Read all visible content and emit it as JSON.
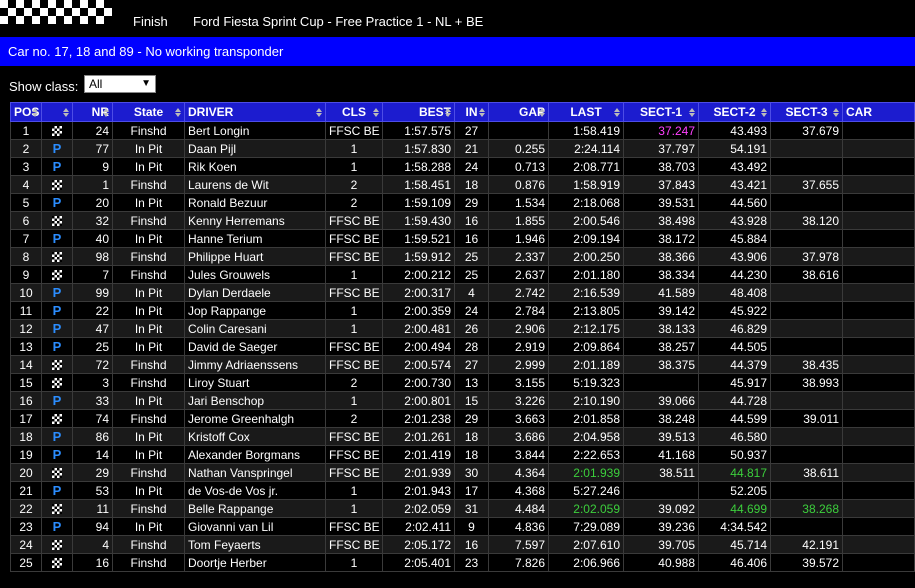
{
  "header": {
    "status": "Finish",
    "title": "Ford Fiesta Sprint Cup - Free Practice 1 - NL + BE"
  },
  "message": "Car no. 17, 18 and 89 - No working transponder",
  "class_filter": {
    "label": "Show class:",
    "value": "All"
  },
  "columns": [
    "POS",
    "",
    "NR",
    "State",
    "DRIVER",
    "CLS",
    "BEST",
    "IN",
    "GAP",
    "LAST",
    "SECT-1",
    "SECT-2",
    "SECT-3",
    "CAR"
  ],
  "colors": {
    "header_bg": "#1c1ccf",
    "message_bg": "#0000ff",
    "pit_icon": "#2b8dff",
    "best_overall": "#ff40ff",
    "personal_best": "#3ccf3c"
  },
  "icons": {
    "finished": "checkered-flag-icon",
    "in_pit": "pit-icon",
    "pit_glyph": "P"
  },
  "rows": [
    {
      "pos": "1",
      "icon": "flag",
      "nr": "24",
      "state": "Finshd",
      "driver": "Bert Longin",
      "cls": "FFSC BE",
      "best": "1:57.575",
      "in": "27",
      "gap": "",
      "last": "1:58.419",
      "s1": "37.247",
      "s2": "43.493",
      "s3": "37.679",
      "car": "",
      "s1c": "purple"
    },
    {
      "pos": "2",
      "icon": "pit",
      "nr": "77",
      "state": "In Pit",
      "driver": "Daan Pijl",
      "cls": "1",
      "best": "1:57.830",
      "in": "21",
      "gap": "0.255",
      "last": "2:24.114",
      "s1": "37.797",
      "s2": "54.191",
      "s3": "",
      "car": ""
    },
    {
      "pos": "3",
      "icon": "pit",
      "nr": "9",
      "state": "In Pit",
      "driver": "Rik Koen",
      "cls": "1",
      "best": "1:58.288",
      "in": "24",
      "gap": "0.713",
      "last": "2:08.771",
      "s1": "38.703",
      "s2": "43.492",
      "s3": "",
      "car": ""
    },
    {
      "pos": "4",
      "icon": "flag",
      "nr": "1",
      "state": "Finshd",
      "driver": "Laurens de Wit",
      "cls": "2",
      "best": "1:58.451",
      "in": "18",
      "gap": "0.876",
      "last": "1:58.919",
      "s1": "37.843",
      "s2": "43.421",
      "s3": "37.655",
      "car": ""
    },
    {
      "pos": "5",
      "icon": "pit",
      "nr": "20",
      "state": "In Pit",
      "driver": "Ronald Bezuur",
      "cls": "2",
      "best": "1:59.109",
      "in": "29",
      "gap": "1.534",
      "last": "2:18.068",
      "s1": "39.531",
      "s2": "44.560",
      "s3": "",
      "car": ""
    },
    {
      "pos": "6",
      "icon": "flag",
      "nr": "32",
      "state": "Finshd",
      "driver": "Kenny Herremans",
      "cls": "FFSC BE",
      "best": "1:59.430",
      "in": "16",
      "gap": "1.855",
      "last": "2:00.546",
      "s1": "38.498",
      "s2": "43.928",
      "s3": "38.120",
      "car": ""
    },
    {
      "pos": "7",
      "icon": "pit",
      "nr": "40",
      "state": "In Pit",
      "driver": "Hanne Terium",
      "cls": "FFSC BE",
      "best": "1:59.521",
      "in": "16",
      "gap": "1.946",
      "last": "2:09.194",
      "s1": "38.172",
      "s2": "45.884",
      "s3": "",
      "car": ""
    },
    {
      "pos": "8",
      "icon": "flag",
      "nr": "98",
      "state": "Finshd",
      "driver": "Philippe Huart",
      "cls": "FFSC BE",
      "best": "1:59.912",
      "in": "25",
      "gap": "2.337",
      "last": "2:00.250",
      "s1": "38.366",
      "s2": "43.906",
      "s3": "37.978",
      "car": ""
    },
    {
      "pos": "9",
      "icon": "flag",
      "nr": "7",
      "state": "Finshd",
      "driver": "Jules Grouwels",
      "cls": "1",
      "best": "2:00.212",
      "in": "25",
      "gap": "2.637",
      "last": "2:01.180",
      "s1": "38.334",
      "s2": "44.230",
      "s3": "38.616",
      "car": ""
    },
    {
      "pos": "10",
      "icon": "pit",
      "nr": "99",
      "state": "In Pit",
      "driver": "Dylan Derdaele",
      "cls": "FFSC BE",
      "best": "2:00.317",
      "in": "4",
      "gap": "2.742",
      "last": "2:16.539",
      "s1": "41.589",
      "s2": "48.408",
      "s3": "",
      "car": ""
    },
    {
      "pos": "11",
      "icon": "pit",
      "nr": "22",
      "state": "In Pit",
      "driver": "Jop Rappange",
      "cls": "1",
      "best": "2:00.359",
      "in": "24",
      "gap": "2.784",
      "last": "2:13.805",
      "s1": "39.142",
      "s2": "45.922",
      "s3": "",
      "car": ""
    },
    {
      "pos": "12",
      "icon": "pit",
      "nr": "47",
      "state": "In Pit",
      "driver": "Colin Caresani",
      "cls": "1",
      "best": "2:00.481",
      "in": "26",
      "gap": "2.906",
      "last": "2:12.175",
      "s1": "38.133",
      "s2": "46.829",
      "s3": "",
      "car": ""
    },
    {
      "pos": "13",
      "icon": "pit",
      "nr": "25",
      "state": "In Pit",
      "driver": "David de Saeger",
      "cls": "FFSC BE",
      "best": "2:00.494",
      "in": "28",
      "gap": "2.919",
      "last": "2:09.864",
      "s1": "38.257",
      "s2": "44.505",
      "s3": "",
      "car": ""
    },
    {
      "pos": "14",
      "icon": "flag",
      "nr": "72",
      "state": "Finshd",
      "driver": "Jimmy Adriaenssens",
      "cls": "FFSC BE",
      "best": "2:00.574",
      "in": "27",
      "gap": "2.999",
      "last": "2:01.189",
      "s1": "38.375",
      "s2": "44.379",
      "s3": "38.435",
      "car": ""
    },
    {
      "pos": "15",
      "icon": "flag",
      "nr": "3",
      "state": "Finshd",
      "driver": "Liroy Stuart",
      "cls": "2",
      "best": "2:00.730",
      "in": "13",
      "gap": "3.155",
      "last": "5:19.323",
      "s1": "",
      "s2": "45.917",
      "s3": "38.993",
      "car": ""
    },
    {
      "pos": "16",
      "icon": "pit",
      "nr": "33",
      "state": "In Pit",
      "driver": "Jari Benschop",
      "cls": "1",
      "best": "2:00.801",
      "in": "15",
      "gap": "3.226",
      "last": "2:10.190",
      "s1": "39.066",
      "s2": "44.728",
      "s3": "",
      "car": ""
    },
    {
      "pos": "17",
      "icon": "flag",
      "nr": "74",
      "state": "Finshd",
      "driver": "Jerome Greenhalgh",
      "cls": "2",
      "best": "2:01.238",
      "in": "29",
      "gap": "3.663",
      "last": "2:01.858",
      "s1": "38.248",
      "s2": "44.599",
      "s3": "39.011",
      "car": ""
    },
    {
      "pos": "18",
      "icon": "pit",
      "nr": "86",
      "state": "In Pit",
      "driver": "Kristoff Cox",
      "cls": "FFSC BE",
      "best": "2:01.261",
      "in": "18",
      "gap": "3.686",
      "last": "2:04.958",
      "s1": "39.513",
      "s2": "46.580",
      "s3": "",
      "car": ""
    },
    {
      "pos": "19",
      "icon": "pit",
      "nr": "14",
      "state": "In Pit",
      "driver": "Alexander Borgmans",
      "cls": "FFSC BE",
      "best": "2:01.419",
      "in": "18",
      "gap": "3.844",
      "last": "2:22.653",
      "s1": "41.168",
      "s2": "50.937",
      "s3": "",
      "car": ""
    },
    {
      "pos": "20",
      "icon": "flag",
      "nr": "29",
      "state": "Finshd",
      "driver": "Nathan Vanspringel",
      "cls": "FFSC BE",
      "best": "2:01.939",
      "in": "30",
      "gap": "4.364",
      "last": "2:01.939",
      "s1": "38.511",
      "s2": "44.817",
      "s3": "38.611",
      "car": "",
      "lastc": "green",
      "s2c": "green"
    },
    {
      "pos": "21",
      "icon": "pit",
      "nr": "53",
      "state": "In Pit",
      "driver": "de Vos-de Vos jr.",
      "cls": "1",
      "best": "2:01.943",
      "in": "17",
      "gap": "4.368",
      "last": "5:27.246",
      "s1": "",
      "s2": "52.205",
      "s3": "",
      "car": ""
    },
    {
      "pos": "22",
      "icon": "flag",
      "nr": "11",
      "state": "Finshd",
      "driver": "Belle Rappange",
      "cls": "1",
      "best": "2:02.059",
      "in": "31",
      "gap": "4.484",
      "last": "2:02.059",
      "s1": "39.092",
      "s2": "44.699",
      "s3": "38.268",
      "car": "",
      "lastc": "green",
      "s2c": "green",
      "s3c": "green"
    },
    {
      "pos": "23",
      "icon": "pit",
      "nr": "94",
      "state": "In Pit",
      "driver": "Giovanni van Lil",
      "cls": "FFSC BE",
      "best": "2:02.411",
      "in": "9",
      "gap": "4.836",
      "last": "7:29.089",
      "s1": "39.236",
      "s2": "4:34.542",
      "s3": "",
      "car": ""
    },
    {
      "pos": "24",
      "icon": "flag",
      "nr": "4",
      "state": "Finshd",
      "driver": "Tom Feyaerts",
      "cls": "FFSC BE",
      "best": "2:05.172",
      "in": "16",
      "gap": "7.597",
      "last": "2:07.610",
      "s1": "39.705",
      "s2": "45.714",
      "s3": "42.191",
      "car": ""
    },
    {
      "pos": "25",
      "icon": "flag",
      "nr": "16",
      "state": "Finshd",
      "driver": "Doortje Herber",
      "cls": "1",
      "best": "2:05.401",
      "in": "23",
      "gap": "7.826",
      "last": "2:06.966",
      "s1": "40.988",
      "s2": "46.406",
      "s3": "39.572",
      "car": ""
    }
  ]
}
